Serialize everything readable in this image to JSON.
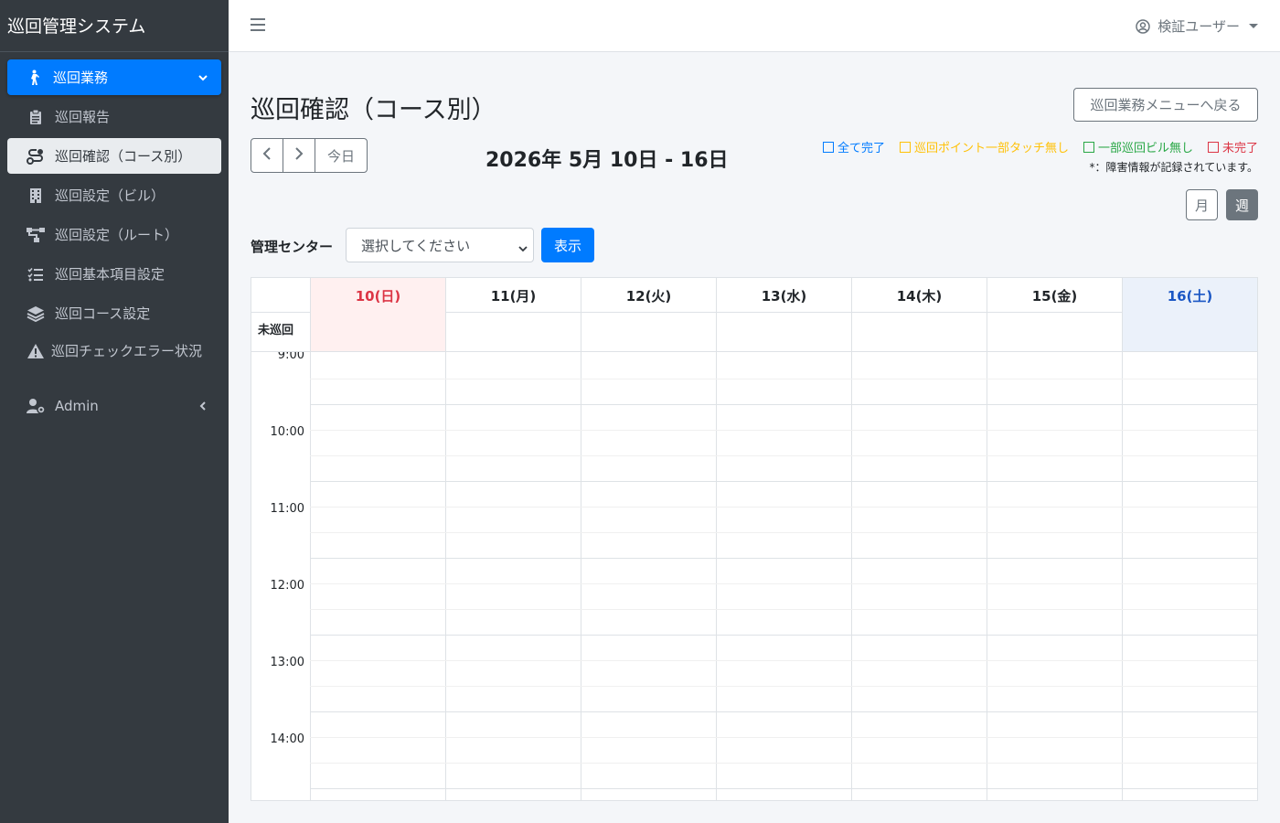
{
  "app": {
    "brand": "巡回管理システム"
  },
  "sidebar": {
    "items": [
      {
        "label": "巡回業務",
        "icon": "walking-icon"
      },
      {
        "label": "巡回報告",
        "icon": "clipboard-icon"
      },
      {
        "label": "巡回確認（コース別）",
        "icon": "route-icon"
      },
      {
        "label": "巡回設定（ビル）",
        "icon": "building-icon"
      },
      {
        "label": "巡回設定（ルート）",
        "icon": "sitemap-icon"
      },
      {
        "label": "巡回基本項目設定",
        "icon": "checklist-icon"
      },
      {
        "label": "巡回コース設定",
        "icon": "layers-icon"
      },
      {
        "label": "巡回チェックエラー状況",
        "icon": "warning-icon"
      },
      {
        "label": "Admin",
        "icon": "user-cog-icon"
      }
    ]
  },
  "topbar": {
    "user_name": "検証ユーザー"
  },
  "page": {
    "title": "巡回確認（コース別）",
    "back_button": "巡回業務メニューへ戻る",
    "today_button": "今日",
    "range_title": "2026年 5月 10日 - 16日",
    "view_month": "月",
    "view_week": "週"
  },
  "legend": {
    "items": [
      {
        "label": "全て完了",
        "color": "#007bff"
      },
      {
        "label": "巡回ポイント一部タッチ無し",
        "color": "#ffc107"
      },
      {
        "label": "一部巡回ビル無し",
        "color": "#28a745"
      },
      {
        "label": "未完了",
        "color": "#dc3545"
      }
    ],
    "note": "*：障害情報が記録されています。"
  },
  "filter": {
    "label": "管理センター",
    "select_value": "選択してください",
    "show_button": "表示"
  },
  "calendar": {
    "allday_label": "未巡回",
    "days": [
      "10(日)",
      "11(月)",
      "12(火)",
      "13(水)",
      "14(木)",
      "15(金)",
      "16(土)"
    ],
    "times": [
      "9:00",
      "10:00",
      "11:00",
      "12:00",
      "13:00",
      "14:00"
    ]
  },
  "colors": {
    "sidebar_bg": "#343a40",
    "primary": "#007bff",
    "secondary": "#6c757d"
  }
}
